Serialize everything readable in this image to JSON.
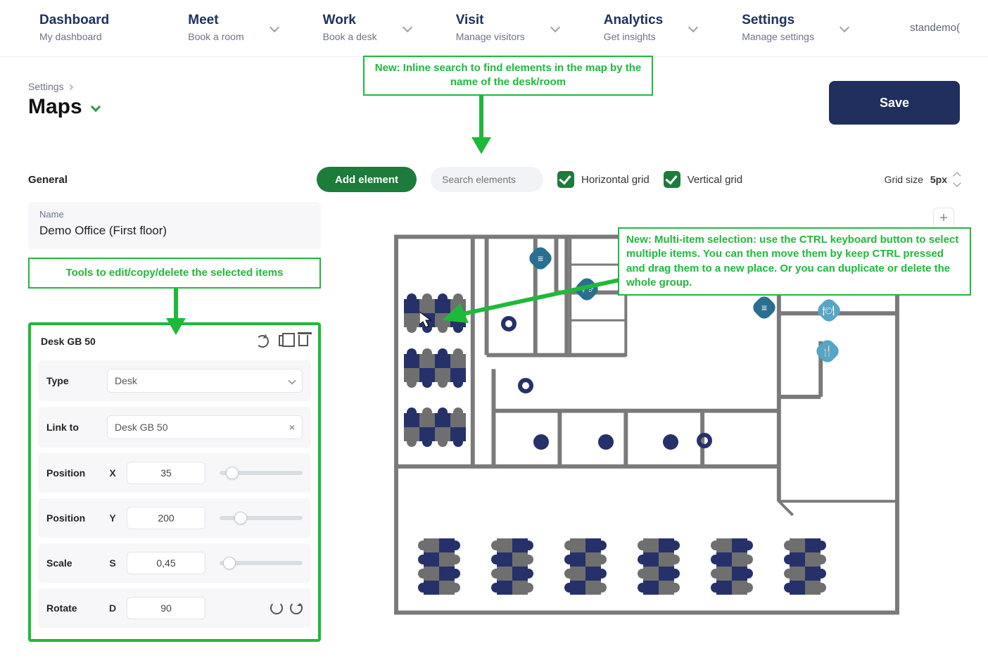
{
  "nav": {
    "items": [
      {
        "title": "Dashboard",
        "sub": "My dashboard",
        "chev": false
      },
      {
        "title": "Meet",
        "sub": "Book a room",
        "chev": true
      },
      {
        "title": "Work",
        "sub": "Book a desk",
        "chev": true
      },
      {
        "title": "Visit",
        "sub": "Manage visitors",
        "chev": true
      },
      {
        "title": "Analytics",
        "sub": "Get insights",
        "chev": true
      },
      {
        "title": "Settings",
        "sub": "Manage settings",
        "chev": true
      }
    ],
    "user": "standemo("
  },
  "header": {
    "crumb": "Settings",
    "page_title": "Maps",
    "save_label": "Save"
  },
  "annotations": {
    "search": "New: Inline search to find elements in the map by the name of the desk/room",
    "tools": "Tools to edit/copy/delete the selected items",
    "multi": "New: Multi-item selection: use the CTRL keyboard button to select multiple items. You can then move them by keep CTRL pressed and drag them to a new place. Or you can duplicate or delete the whole group."
  },
  "toolbar": {
    "general_tab": "General",
    "add_label": "Add element",
    "search_placeholder": "Search elements",
    "horizontal": "Horizontal grid",
    "vertical": "Vertical grid",
    "grid_size_label": "Grid size",
    "grid_size_value": "5px"
  },
  "map_name": {
    "label": "Name",
    "value": "Demo Office (First floor)"
  },
  "props": {
    "title": "Desk GB 50",
    "type_label": "Type",
    "type_value": "Desk",
    "link_label": "Link to",
    "link_value": "Desk GB 50",
    "pos_label": "Position",
    "x_label": "X",
    "x_value": "35",
    "y_label": "Y",
    "y_value": "200",
    "scale_label": "Scale",
    "s_label": "S",
    "s_value": "0,45",
    "rotate_label": "Rotate",
    "d_label": "D",
    "d_value": "90"
  },
  "colors": {
    "navy": "#202f5d",
    "green": "#1d7b3b",
    "annotation": "#1fb93a"
  }
}
